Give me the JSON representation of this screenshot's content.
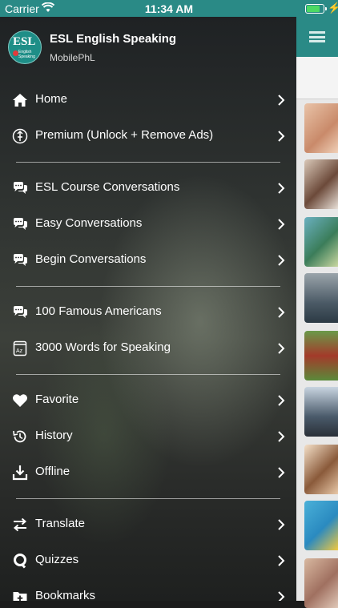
{
  "status_bar": {
    "carrier": "Carrier",
    "time": "11:34 AM",
    "battery_level": 0.9
  },
  "app": {
    "logo_text": "ESL",
    "logo_subtext": "English Speaking",
    "title": "ESL English Speaking",
    "subtitle": "MobilePhL"
  },
  "menu": {
    "items": [
      {
        "label": "Home",
        "icon": "home-icon"
      },
      {
        "label": "Premium (Unlock + Remove Ads)",
        "icon": "premium-icon"
      },
      {
        "label": "ESL Course Conversations",
        "icon": "chat-bubbles-icon"
      },
      {
        "label": "Easy Conversations",
        "icon": "chat-bubbles-icon"
      },
      {
        "label": "Begin Conversations",
        "icon": "chat-bubbles-icon"
      },
      {
        "label": "100 Famous Americans",
        "icon": "chat-bubbles-icon"
      },
      {
        "label": "3000 Words for Speaking",
        "icon": "dictionary-icon"
      },
      {
        "label": "Favorite",
        "icon": "heart-icon"
      },
      {
        "label": "History",
        "icon": "history-icon"
      },
      {
        "label": "Offline",
        "icon": "download-icon"
      },
      {
        "label": "Translate",
        "icon": "swap-arrows-icon"
      },
      {
        "label": "Quizzes",
        "icon": "quiz-icon"
      },
      {
        "label": "Bookmarks",
        "icon": "folder-add-icon"
      }
    ]
  },
  "colors": {
    "accent": "#2a8a86",
    "drawer_text": "#ffffff",
    "battery_fill": "#4cd964"
  }
}
